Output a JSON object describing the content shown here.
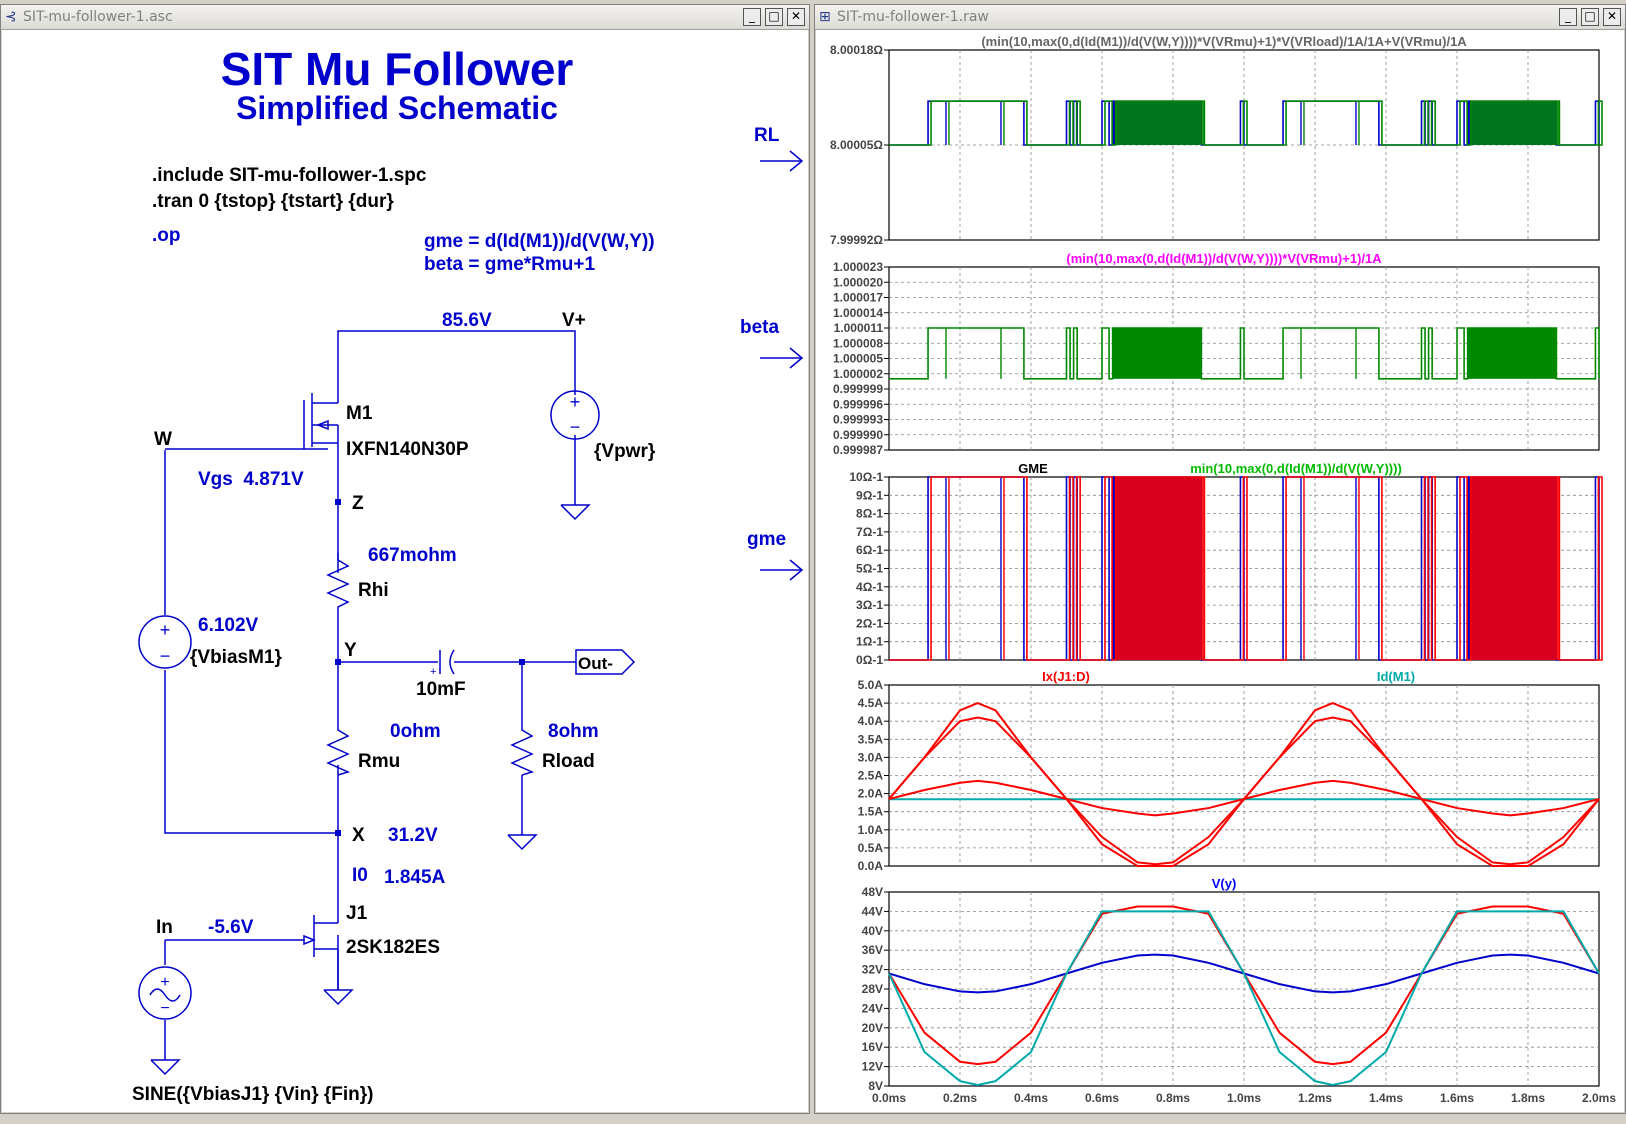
{
  "schematic_window": {
    "title": "SIT-mu-follower-1.asc",
    "heading": "SIT Mu Follower",
    "subheading": "Simplified Schematic",
    "directives": [
      ".include SIT-mu-follower-1.spc",
      ".tran 0 {tstop} {tstart} {dur}"
    ],
    "op_directive": ".op",
    "equations": [
      "gme = d(Id(M1))/d(V(W,Y))",
      "beta = gme*Rmu+1"
    ],
    "labels": {
      "vplus_voltage": "85.6V",
      "vplus": "V+",
      "m1": "M1",
      "m1_part": "IXFN140N30P",
      "w": "W",
      "vgs": "Vgs  4.871V",
      "z": "Z",
      "vpwr": "{Vpwr}",
      "rhi_value": "667mohm",
      "rhi": "Rhi",
      "vbias_voltage": "6.102V",
      "vbias": "{VbiasM1}",
      "y": "Y",
      "cap_value": "10mF",
      "out": "Out-",
      "rmu_value": "0ohm",
      "rmu": "Rmu",
      "rload_value": "8ohm",
      "rload": "Rload",
      "x": "X",
      "x_voltage": "31.2V",
      "i0": "I0",
      "i0_value": "1.845A",
      "j1": "J1",
      "j1_part": "2SK182ES",
      "in": "In",
      "in_voltage": "-5.6V",
      "sine": "SINE({VbiasJ1} {Vin} {Fin})"
    },
    "arrow_labels": [
      "RL",
      "beta",
      "gme"
    ]
  },
  "waveform_window": {
    "title": "SIT-mu-follower-1.raw",
    "x_ticks": [
      "0.0ms",
      "0.2ms",
      "0.4ms",
      "0.6ms",
      "0.8ms",
      "1.0ms",
      "1.2ms",
      "1.4ms",
      "1.6ms",
      "1.8ms",
      "2.0ms"
    ],
    "panes": [
      {
        "traces": [
          {
            "label": "(min(10,max(0,d(Id(M1))/d(V(W,Y))))*V(VRmu)+1)*V(VRload)/1A/1A+V(VRmu)/1A",
            "color": "#666666"
          }
        ],
        "y_ticks": [
          "8.00018Ω",
          "8.00005Ω",
          "7.99992Ω"
        ]
      },
      {
        "traces": [
          {
            "label": "(min(10,max(0,d(Id(M1))/d(V(W,Y))))*V(VRmu)+1)/1A",
            "color": "#ff00ff"
          }
        ],
        "y_ticks": [
          "1.000023",
          "1.000020",
          "1.000017",
          "1.000014",
          "1.000011",
          "1.000008",
          "1.000005",
          "1.000002",
          "0.999999",
          "0.999996",
          "0.999993",
          "0.999990",
          "0.999987"
        ]
      },
      {
        "traces": [
          {
            "label": "GME",
            "color": "#000000"
          },
          {
            "label": "min(10,max(0,d(Id(M1))/d(V(W,Y))))",
            "color": "#00bb00"
          }
        ],
        "y_ticks": [
          "10Ω-1",
          "9Ω-1",
          "8Ω-1",
          "7Ω-1",
          "6Ω-1",
          "5Ω-1",
          "4Ω-1",
          "3Ω-1",
          "2Ω-1",
          "1Ω-1",
          "0Ω-1"
        ]
      },
      {
        "traces": [
          {
            "label": "Ix(J1:D)",
            "color": "#ff0000"
          },
          {
            "label": "Id(M1)",
            "color": "#00aaaa"
          }
        ],
        "y_ticks": [
          "5.0A",
          "4.5A",
          "4.0A",
          "3.5A",
          "3.0A",
          "2.5A",
          "2.0A",
          "1.5A",
          "1.0A",
          "0.5A",
          "0.0A"
        ]
      },
      {
        "traces": [
          {
            "label": "V(y)",
            "color": "#0000ff"
          }
        ],
        "y_ticks": [
          "48V",
          "44V",
          "40V",
          "36V",
          "32V",
          "28V",
          "24V",
          "20V",
          "16V",
          "12V",
          "8V"
        ]
      }
    ]
  },
  "chart_data": [
    {
      "type": "line",
      "title": "",
      "ylabel": "Ω",
      "ylim": [
        7.99992,
        8.00018
      ],
      "series": [
        {
          "name": "(min(10,max(0,d(Id(M1))/d(V(W,Y))))*V(VRmu)+1)*V(VRload)/1A/1A+V(VRmu)/1A",
          "values": [
            8.00005,
            8.00011
          ]
        }
      ]
    },
    {
      "type": "line",
      "title": "",
      "ylim": [
        0.999987,
        1.000023
      ],
      "series": [
        {
          "name": "(min(10,max(0,d(Id(M1))/d(V(W,Y))))*V(VRmu)+1)/1A",
          "values": [
            1.000001,
            1.000011
          ]
        }
      ]
    },
    {
      "type": "line",
      "title": "",
      "ylim": [
        0,
        10
      ],
      "series": [
        {
          "name": "GME",
          "values": [
            0,
            10
          ]
        },
        {
          "name": "min(10,max(0,d(Id(M1))/d(V(W,Y))))",
          "values": [
            0,
            10
          ]
        }
      ]
    },
    {
      "type": "line",
      "title": "",
      "ylim": [
        0,
        5
      ],
      "x": [
        0.0,
        0.1,
        0.2,
        0.25,
        0.3,
        0.4,
        0.5,
        0.6,
        0.7,
        0.75,
        0.8,
        0.9,
        1.0,
        1.1,
        1.2,
        1.25,
        1.3,
        1.4,
        1.5,
        1.6,
        1.7,
        1.75,
        1.8,
        1.9,
        2.0
      ],
      "series": [
        {
          "name": "Ix(J1:D)",
          "values": [
            1.85,
            3.0,
            4.3,
            4.5,
            4.3,
            3.0,
            1.85,
            0.6,
            0.0,
            0.0,
            0.0,
            0.6,
            1.85,
            3.0,
            4.3,
            4.5,
            4.3,
            3.0,
            1.85,
            0.6,
            0.0,
            0.0,
            0.0,
            0.6,
            1.85
          ]
        },
        {
          "name": "Id(M1)",
          "values": [
            1.845,
            1.845,
            1.845,
            1.845,
            1.845,
            1.845,
            1.845,
            1.845,
            1.845,
            1.845,
            1.845,
            1.845,
            1.845,
            1.845,
            1.845,
            1.845,
            1.845,
            1.845,
            1.845,
            1.845,
            1.845,
            1.845,
            1.845,
            1.845,
            1.845
          ]
        }
      ]
    },
    {
      "type": "line",
      "title": "",
      "ylim": [
        8,
        48
      ],
      "x": [
        0.0,
        0.1,
        0.2,
        0.25,
        0.3,
        0.4,
        0.5,
        0.6,
        0.7,
        0.75,
        0.8,
        0.9,
        1.0,
        1.1,
        1.2,
        1.25,
        1.3,
        1.4,
        1.5,
        1.6,
        1.7,
        1.75,
        1.8,
        1.9,
        2.0
      ],
      "series": [
        {
          "name": "V(y)",
          "values": [
            31.2,
            29.0,
            27.5,
            27.3,
            27.5,
            29.0,
            31.2,
            33.4,
            34.9,
            35.1,
            34.9,
            33.4,
            31.2,
            29.0,
            27.5,
            27.3,
            27.5,
            29.0,
            31.2,
            33.4,
            34.9,
            35.1,
            34.9,
            33.4,
            31.2
          ]
        },
        {
          "name": "",
          "values": [
            31.2,
            19.0,
            13.0,
            12.5,
            13.0,
            19.0,
            31.2,
            43.5,
            45.0,
            45.0,
            45.0,
            43.5,
            31.2,
            19.0,
            13.0,
            12.5,
            13.0,
            19.0,
            31.2,
            43.5,
            45.0,
            45.0,
            45.0,
            43.5,
            31.2
          ]
        },
        {
          "name": "",
          "values": [
            31.2,
            15.0,
            9.0,
            8.2,
            9.0,
            15.0,
            31.2,
            44.0,
            44.0,
            44.0,
            44.0,
            44.0,
            31.2,
            15.0,
            9.0,
            8.2,
            9.0,
            15.0,
            31.2,
            44.0,
            44.0,
            44.0,
            44.0,
            44.0,
            31.2
          ]
        }
      ]
    }
  ],
  "colors": {
    "schematic_text": "#0000cc",
    "wire": "#0000cc",
    "grid": "#888888"
  }
}
